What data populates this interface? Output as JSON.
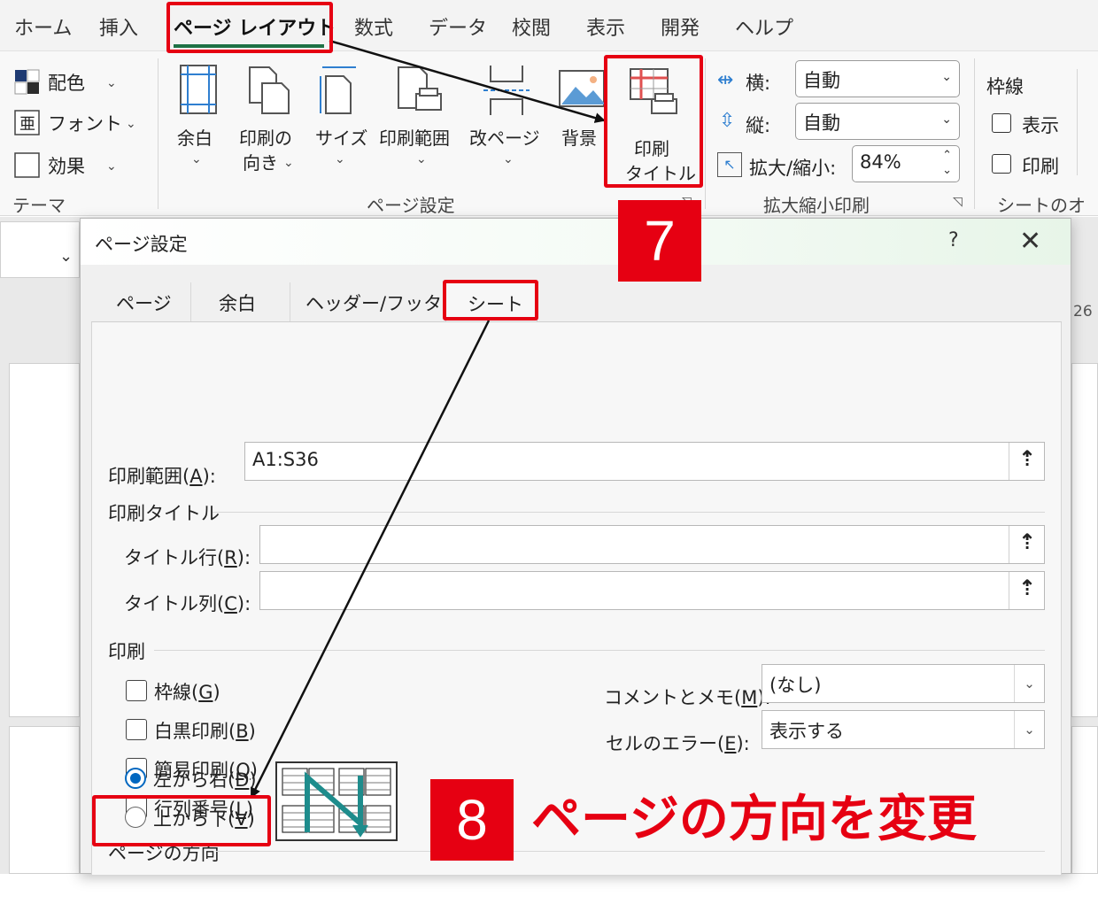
{
  "ribbon": {
    "tabs": [
      {
        "label": "ホーム"
      },
      {
        "label": "挿入"
      },
      {
        "label": "ページ レイアウト"
      },
      {
        "label": "数式"
      },
      {
        "label": "データ"
      },
      {
        "label": "校閲"
      },
      {
        "label": "表示"
      },
      {
        "label": "開発"
      },
      {
        "label": "ヘルプ"
      }
    ],
    "theme": {
      "colors": "配色",
      "fonts": "フォント",
      "effects": "効果",
      "group": "テーマ"
    },
    "page_setup": {
      "margins": "余白",
      "orientation_1": "印刷の",
      "orientation_2": "向き",
      "size": "サイズ",
      "print_area": "印刷範囲",
      "breaks": "改ページ",
      "background": "背景",
      "print_titles_1": "印刷",
      "print_titles_2": "タイトル",
      "group": "ページ設定"
    },
    "scale": {
      "width_label": "横:",
      "width_value": "自動",
      "height_label": "縦:",
      "height_value": "自動",
      "scale_label": "拡大/縮小:",
      "scale_value": "84%",
      "group": "拡大縮小印刷"
    },
    "sheet_options": {
      "gridlines": "枠線",
      "view": "表示",
      "print": "印刷",
      "group": "シートのオプ"
    }
  },
  "sheet": {
    "col_number": "26"
  },
  "dialog": {
    "title": "ページ設定",
    "help": "?",
    "close": "✕",
    "tabs": [
      {
        "label": "ページ"
      },
      {
        "label": "余白"
      },
      {
        "label": "ヘッダー/フッター"
      },
      {
        "label": "シート"
      }
    ],
    "print_area": {
      "label": "印刷範囲(",
      "key": "A",
      "suffix": "):",
      "value": "A1:S36"
    },
    "print_titles": {
      "section": "印刷タイトル",
      "rows_label": "タイトル行(",
      "rows_key": "R",
      "rows_suffix": "):",
      "rows_value": "",
      "cols_label": "タイトル列(",
      "cols_key": "C",
      "cols_suffix": "):",
      "cols_value": ""
    },
    "print": {
      "section": "印刷",
      "gridlines": "枠線(",
      "gridlines_key": "G",
      "bw": "白黒印刷(",
      "bw_key": "B",
      "draft": "簡易印刷(",
      "draft_key": "Q",
      "headings": "行列番号(",
      "headings_key": "L",
      "close_paren": ")",
      "comments_label": "コメントとメモ(",
      "comments_key": "M",
      "comments_suffix": "):",
      "comments_value": "(なし)",
      "errors_label": "セルのエラー(",
      "errors_key": "E",
      "errors_suffix": "):",
      "errors_value": "表示する"
    },
    "page_order": {
      "section": "ページの方向",
      "ltr": "左から右(",
      "ltr_key": "D",
      "ttb": "上から下(",
      "ttb_key": "V",
      "close_paren": ")",
      "selected": "ltr"
    }
  },
  "annotations": {
    "step7": "7",
    "step8": "8",
    "instruction": "ページの方向を変更",
    "color": "#e60012"
  }
}
